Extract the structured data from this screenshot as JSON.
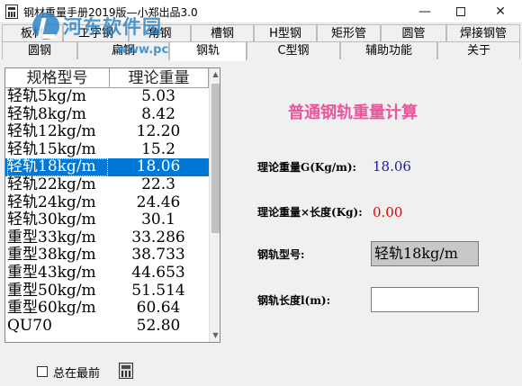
{
  "window": {
    "title": "钢材重量手册2019版—小郑出品3.0",
    "min_glyph": "—",
    "close_glyph": "✕"
  },
  "watermark": {
    "text": "河东软件园",
    "url": "www.pc0359.cn"
  },
  "tabs_row1": [
    "板材",
    "工字钢",
    "角钢",
    "槽钢",
    "H型钢",
    "矩形管",
    "圆管",
    "焊接钢管"
  ],
  "tabs_row2": [
    "圆钢",
    "扁钢",
    "钢轨",
    "C型钢",
    "辅助功能",
    "关于"
  ],
  "list": {
    "headers": [
      "规格型号",
      "理论重量"
    ],
    "rows": [
      {
        "type": "轻轨5kg/m",
        "weight": "5.03"
      },
      {
        "type": "轻轨8kg/m",
        "weight": "8.42"
      },
      {
        "type": "轻轨12kg/m",
        "weight": "12.20"
      },
      {
        "type": "轻轨15kg/m",
        "weight": "15.2"
      },
      {
        "type": "轻轨18kg/m",
        "weight": "18.06"
      },
      {
        "type": "轻轨22kg/m",
        "weight": "22.3"
      },
      {
        "type": "轻轨24kg/m",
        "weight": "24.46"
      },
      {
        "type": "轻轨30kg/m",
        "weight": "30.1"
      },
      {
        "type": "重型33kg/m",
        "weight": "33.286"
      },
      {
        "type": "重型38kg/m",
        "weight": "38.733"
      },
      {
        "type": "重型43kg/m",
        "weight": "44.653"
      },
      {
        "type": "重型50kg/m",
        "weight": "51.514"
      },
      {
        "type": "重型60kg/m",
        "weight": "60.64"
      },
      {
        "type": "QU70",
        "weight": "52.80"
      }
    ],
    "selected_index": 4
  },
  "calc": {
    "title": "普通钢轨重量计算",
    "theoretical_weight_label": "理论重量G(Kg/m):",
    "theoretical_weight_value": "18.06",
    "weight_x_length_label": "理论重量×长度(Kg):",
    "weight_x_length_value": "0.00",
    "rail_type_label": "钢轨型号:",
    "rail_type_value": "轻轨18kg/m",
    "rail_length_label": "钢轨长度l(m):",
    "rail_length_value": ""
  },
  "bottom": {
    "always_on_top_label": "总在最前"
  },
  "colors": {
    "selection": "#0078d7",
    "title_pink": "#e8579c",
    "value_blue": "#1a1aa0",
    "value_red": "#e00000",
    "watermark": "#2e86c9"
  }
}
